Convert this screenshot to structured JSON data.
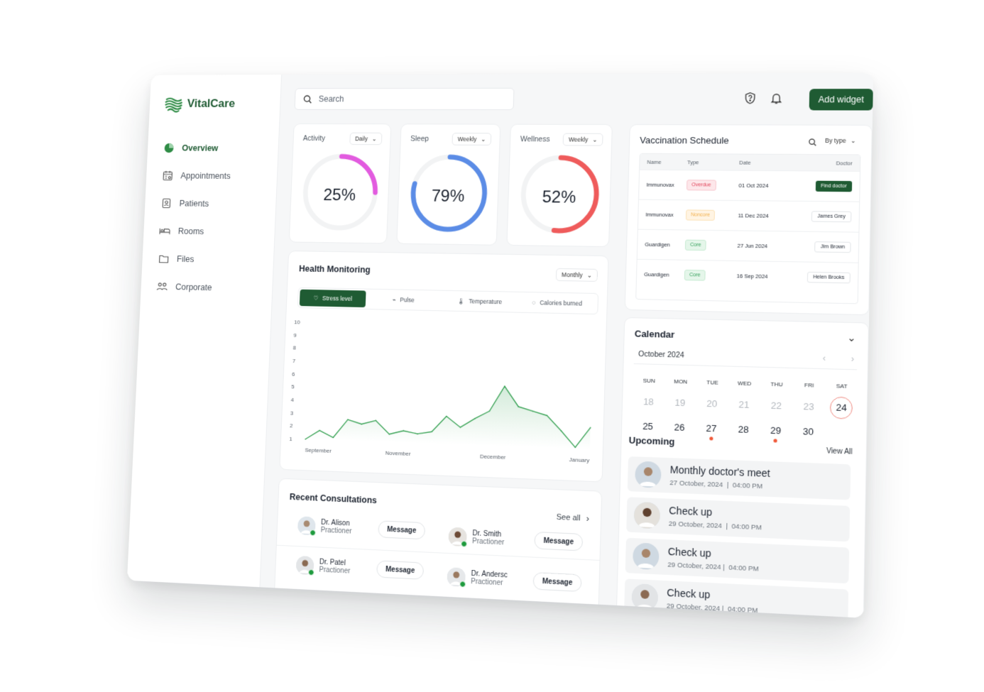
{
  "app": {
    "brand": "VitalCare"
  },
  "sidebar": {
    "items": [
      {
        "label": "Overview",
        "icon": "pie-chart-icon",
        "active": true
      },
      {
        "label": "Appointments",
        "icon": "calendar-list-icon"
      },
      {
        "label": "Patients",
        "icon": "patient-badge-icon"
      },
      {
        "label": "Rooms",
        "icon": "bed-icon"
      },
      {
        "label": "Files",
        "icon": "folder-icon"
      },
      {
        "label": "Corporate",
        "icon": "people-icon"
      }
    ]
  },
  "topbar": {
    "search_placeholder": "Search",
    "add_widget": "Add widget"
  },
  "gauges": [
    {
      "title": "Activity",
      "period": "Daily",
      "percent": 25,
      "value_text": "25%",
      "color": "#e25bdf"
    },
    {
      "title": "Sleep",
      "period": "Weekly",
      "percent": 79,
      "value_text": "79%",
      "color": "#5b8ce6"
    },
    {
      "title": "Wellness",
      "period": "Weekly",
      "percent": 52,
      "value_text": "52%",
      "color": "#ef5b5b"
    }
  ],
  "health": {
    "title": "Health Monitoring",
    "period": "Monthly",
    "tabs": [
      {
        "label": "Stress level",
        "icon": "heart-icon",
        "active": true
      },
      {
        "label": "Pulse",
        "icon": "pulse-icon"
      },
      {
        "label": "Temperature",
        "icon": "thermometer-icon"
      },
      {
        "label": "Calories burned",
        "icon": "flame-icon"
      }
    ]
  },
  "chart_data": {
    "type": "area",
    "title": "",
    "xlabel": "",
    "ylabel": "",
    "x_tick_labels": [
      "September",
      "November",
      "December",
      "January"
    ],
    "y_ticks": [
      1,
      2,
      3,
      4,
      5,
      6,
      7,
      8,
      9,
      10
    ],
    "ylim": [
      1,
      10
    ],
    "xlim": [
      0,
      20
    ],
    "grid": false,
    "color": "#3aa356",
    "points": [
      {
        "x": 0,
        "y": 1
      },
      {
        "x": 1,
        "y": 1.7
      },
      {
        "x": 2,
        "y": 1.2
      },
      {
        "x": 3,
        "y": 2.6
      },
      {
        "x": 4,
        "y": 2.3
      },
      {
        "x": 5,
        "y": 2.6
      },
      {
        "x": 6,
        "y": 1.6
      },
      {
        "x": 7,
        "y": 1.9
      },
      {
        "x": 8,
        "y": 1.7
      },
      {
        "x": 9,
        "y": 1.9
      },
      {
        "x": 10,
        "y": 3.1
      },
      {
        "x": 11,
        "y": 2.3
      },
      {
        "x": 12,
        "y": 3.0
      },
      {
        "x": 13,
        "y": 3.6
      },
      {
        "x": 14,
        "y": 5.5
      },
      {
        "x": 15,
        "y": 4.0
      },
      {
        "x": 16,
        "y": 3.7
      },
      {
        "x": 17,
        "y": 3.4
      },
      {
        "x": 18,
        "y": 2.3
      },
      {
        "x": 19,
        "y": 1.1
      },
      {
        "x": 20,
        "y": 2.6
      }
    ]
  },
  "consultations": {
    "title": "Recent Consultations",
    "see_all": "See all",
    "doctors": [
      {
        "name": "Dr. Alison",
        "role": "Practioner",
        "online": true,
        "button": "Message"
      },
      {
        "name": "Dr. Smith",
        "role": "Practioner",
        "online": true,
        "button": "Message"
      },
      {
        "name": "Dr. Patel",
        "role": "Practioner",
        "online": true,
        "button": "Message"
      },
      {
        "name": "Dr. Andersc",
        "role": "Practioner",
        "online": true,
        "button": "Message"
      }
    ]
  },
  "vaccination": {
    "title": "Vaccination  Schedule",
    "filter": "By type",
    "columns": [
      "Name",
      "Type",
      "Date",
      "Doctor"
    ],
    "rows": [
      {
        "name": "Immunovax",
        "type": "Overdue",
        "type_style": "overdue",
        "date": "01 Oct 2024",
        "doctor": "Find doctor",
        "doctor_is_action": true
      },
      {
        "name": "Immunovax",
        "type": "Noncore",
        "type_style": "noncore",
        "date": "11 Dec 2024",
        "doctor": "James Grey"
      },
      {
        "name": "Guardigen",
        "type": "Core",
        "type_style": "core",
        "date": "27 Jun 2024",
        "doctor": "Jim Brown"
      },
      {
        "name": "Guardigen",
        "type": "Core",
        "type_style": "core",
        "date": "16 Sep 2024",
        "doctor": "Helen Brooks"
      }
    ]
  },
  "calendar": {
    "title": "Calendar",
    "month": "October 2024",
    "days_of_week": [
      "SUN",
      "MON",
      "TUE",
      "WED",
      "THU",
      "FRI",
      "SAT"
    ],
    "weeks": [
      [
        {
          "d": "18",
          "muted": true
        },
        {
          "d": "19",
          "muted": true
        },
        {
          "d": "20",
          "muted": true
        },
        {
          "d": "21",
          "muted": true
        },
        {
          "d": "22",
          "muted": true
        },
        {
          "d": "23",
          "muted": true
        },
        {
          "d": "24",
          "today": true
        }
      ],
      [
        {
          "d": "25"
        },
        {
          "d": "26"
        },
        {
          "d": "27",
          "dot": true
        },
        {
          "d": "28"
        },
        {
          "d": "29",
          "dot": true
        },
        {
          "d": "30"
        },
        {
          "d": ""
        }
      ]
    ]
  },
  "upcoming": {
    "title": "Upcoming",
    "view_all": "View All",
    "items": [
      {
        "title": "Monthly doctor's meet",
        "date": "27 October, 2024",
        "time": "04:00 PM",
        "sep": "  |  "
      },
      {
        "title": "Check up",
        "date": "29 October, 2024",
        "time": "04:00 PM",
        "sep": "  |  "
      },
      {
        "title": "Check up",
        "date": "29 October, 2024",
        "time": "04:00 PM",
        "sep": " |  "
      },
      {
        "title": "Check up",
        "date": "29 October, 2024",
        "time": "04:00 PM",
        "sep": " |  "
      }
    ]
  }
}
